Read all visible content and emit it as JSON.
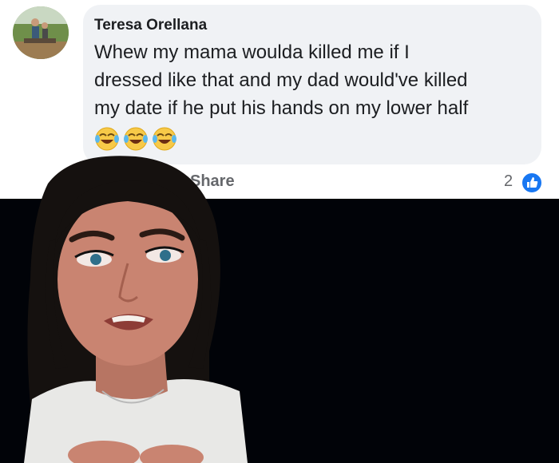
{
  "comment": {
    "author": "Teresa Orellana",
    "lines": [
      "Whew my mama woulda killed me if I",
      "dressed like that and my dad would've killed",
      "my date if he put his hands on my lower half"
    ],
    "emojis": [
      "face-with-tears-of-joy",
      "face-with-tears-of-joy",
      "face-with-tears-of-joy"
    ]
  },
  "actions": {
    "share_label": "Share",
    "reaction_count": "2",
    "reaction_icon": "like-icon"
  },
  "colors": {
    "bubble": "#f0f2f5",
    "like_blue": "#1877f2",
    "meta_gray": "#65676b",
    "video_bg": "#010308"
  }
}
